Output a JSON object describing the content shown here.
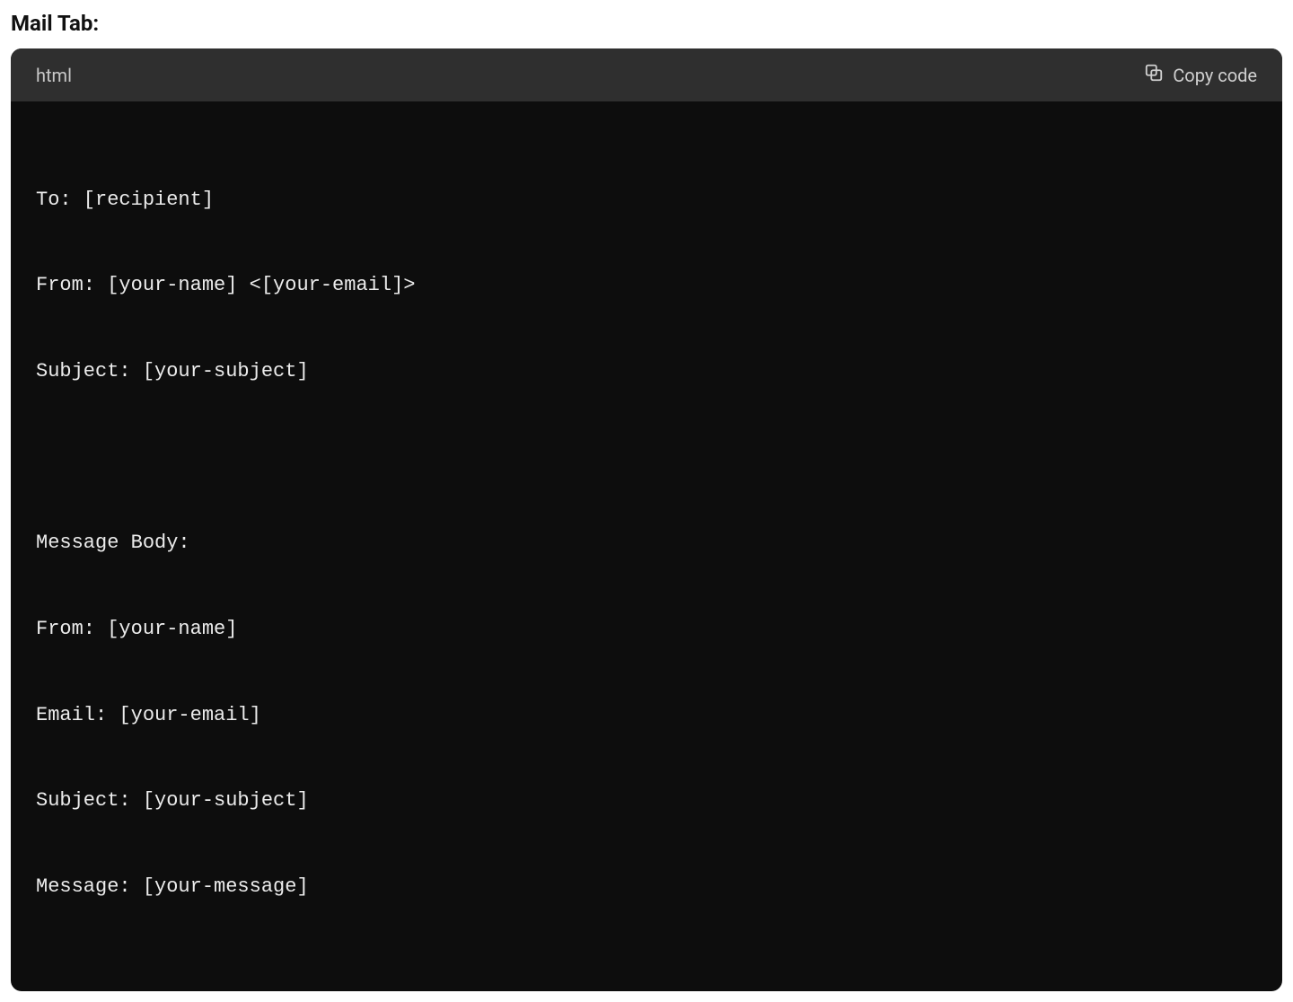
{
  "heading": "Mail Tab:",
  "codeBlock": {
    "language": "html",
    "copyLabel": "Copy code",
    "lines": [
      "To: [recipient]",
      "From: [your-name] <[your-email]>",
      "Subject: [your-subject]",
      "",
      "Message Body:",
      "From: [your-name]",
      "Email: [your-email]",
      "Subject: [your-subject]",
      "Message: [your-message]"
    ]
  }
}
